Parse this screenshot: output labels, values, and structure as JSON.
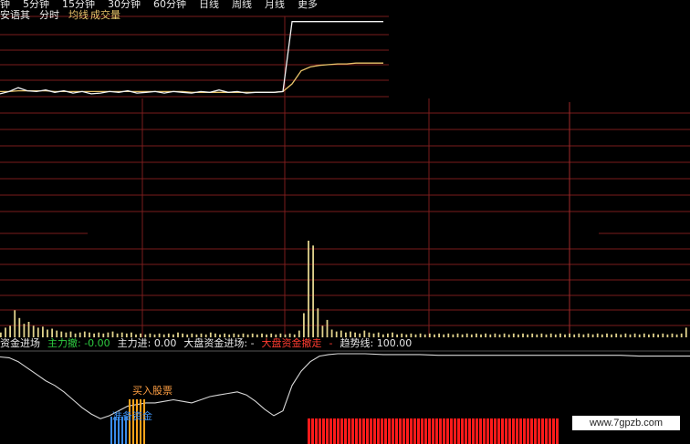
{
  "colors": {
    "background": "#000000",
    "grid_red": "#7a1d1d",
    "price_white": "#f2f2f2",
    "avg_yellow": "#e9c46a",
    "vol_bar": "#e0d28c",
    "legend_green": "#2ecc40",
    "legend_red": "#ff3b30",
    "text_white": "#e8e8e8",
    "buy_label": "#ff9f43",
    "blue_bar": "#3a8be8",
    "orange_bar": "#ffa31a",
    "red_block": "#ff1a1a"
  },
  "tabs": [
    "钟",
    "5分钟",
    "15分钟",
    "30分钟",
    "60分钟",
    "日线",
    "周线",
    "月线",
    "更多"
  ],
  "toolbar2": {
    "item1": "安语其",
    "item2": "分时",
    "item3": "均线",
    "item4": "成交量"
  },
  "indicator_legend": {
    "name": "资金进场",
    "zl_out": "主力撤: -0.00",
    "zl_in": "主力进: 0.00",
    "market_in": "大盘资金进场: -",
    "market_out": "大盘资金撤走",
    "dash": "-",
    "trend": "趋势线: 100.00"
  },
  "labels": {
    "buy_stock": "买入股票",
    "prepare_funds": "准备资金"
  },
  "watermark": "www.7gpzb.com",
  "chart_data": [
    {
      "type": "line",
      "panel": "intraday price",
      "x": [
        0,
        10,
        20,
        30,
        40,
        50,
        60,
        70,
        80,
        90,
        100,
        110,
        120,
        130,
        140,
        150,
        160,
        170,
        180,
        190,
        200,
        210,
        220,
        230,
        240,
        250,
        260,
        270,
        280,
        290,
        300,
        310,
        320,
        330,
        340,
        350,
        360,
        370,
        380,
        390,
        400,
        410,
        420
      ],
      "series": [
        {
          "values": [
            0.6,
            0.9,
            1.4,
            1.0,
            0.9,
            1.1,
            0.8,
            1.0,
            0.7,
            0.9,
            0.6,
            0.7,
            0.9,
            0.8,
            1.0,
            0.7,
            0.8,
            0.9,
            0.7,
            0.9,
            0.8,
            0.7,
            0.9,
            0.8,
            1.1,
            0.8,
            0.9,
            0.7,
            0.8,
            0.8,
            0.8,
            0.9,
            10.0,
            10.0,
            10.0,
            10.0,
            10.0,
            10.0,
            10.0,
            10.0,
            10.0,
            10.0,
            10.0
          ]
        },
        {
          "values": [
            0.9,
            0.9,
            1.0,
            1.0,
            1.0,
            1.0,
            0.9,
            0.9,
            0.9,
            0.9,
            0.9,
            0.9,
            0.9,
            0.9,
            0.9,
            0.9,
            0.9,
            0.9,
            0.9,
            0.9,
            0.9,
            0.8,
            0.8,
            0.8,
            0.8,
            0.8,
            0.8,
            0.8,
            0.8,
            0.8,
            0.8,
            0.9,
            1.9,
            3.6,
            4.1,
            4.3,
            4.4,
            4.5,
            4.5,
            4.6,
            4.6,
            4.6,
            4.6
          ]
        }
      ]
    },
    {
      "type": "bar",
      "panel": "volume",
      "values": [
        0.05,
        0.1,
        0.12,
        0.28,
        0.2,
        0.14,
        0.16,
        0.12,
        0.1,
        0.11,
        0.08,
        0.09,
        0.07,
        0.06,
        0.05,
        0.06,
        0.04,
        0.05,
        0.06,
        0.05,
        0.04,
        0.05,
        0.04,
        0.05,
        0.06,
        0.04,
        0.05,
        0.04,
        0.05,
        0.03,
        0.04,
        0.03,
        0.04,
        0.03,
        0.04,
        0.03,
        0.04,
        0.03,
        0.05,
        0.04,
        0.03,
        0.04,
        0.03,
        0.04,
        0.03,
        0.05,
        0.04,
        0.03,
        0.04,
        0.03,
        0.04,
        0.03,
        0.04,
        0.03,
        0.04,
        0.03,
        0.04,
        0.03,
        0.04,
        0.03,
        0.04,
        0.03,
        0.04,
        0.03,
        0.07,
        0.25,
        1.0,
        0.95,
        0.3,
        0.12,
        0.18,
        0.08,
        0.06,
        0.07,
        0.05,
        0.06,
        0.05,
        0.04,
        0.07,
        0.05,
        0.04,
        0.05,
        0.03,
        0.04,
        0.05,
        0.03,
        0.04,
        0.03,
        0.04,
        0.03,
        0.04,
        0.03,
        0.04,
        0.03,
        0.04,
        0.03,
        0.04,
        0.03,
        0.04,
        0.03,
        0.04,
        0.03,
        0.04,
        0.03,
        0.04,
        0.03,
        0.04,
        0.03,
        0.04,
        0.03,
        0.04,
        0.03,
        0.04,
        0.03,
        0.04,
        0.03,
        0.04,
        0.03,
        0.04,
        0.03,
        0.04,
        0.03,
        0.04,
        0.03,
        0.04,
        0.03,
        0.04,
        0.03,
        0.04,
        0.03,
        0.04,
        0.03,
        0.04,
        0.03,
        0.04,
        0.03,
        0.04,
        0.03,
        0.04,
        0.03,
        0.04,
        0.03,
        0.04,
        0.03,
        0.04,
        0.03,
        0.04,
        0.1
      ]
    },
    {
      "type": "line",
      "panel": "indicator trend",
      "x": [
        0,
        10,
        20,
        30,
        40,
        50,
        60,
        70,
        80,
        90,
        100,
        110,
        120,
        130,
        140,
        150,
        160,
        170,
        180,
        190,
        200,
        210,
        220,
        230,
        240,
        250,
        260,
        270,
        280,
        290,
        300,
        310,
        320,
        330,
        340,
        350,
        360,
        370,
        380,
        390,
        400,
        420,
        440,
        460,
        480,
        500,
        520,
        540,
        560,
        580,
        600,
        620,
        640,
        660,
        680,
        700,
        720,
        740,
        756
      ],
      "values": [
        96,
        95,
        90,
        82,
        74,
        66,
        60,
        52,
        42,
        32,
        24,
        18,
        22,
        28,
        34,
        36,
        38,
        38,
        40,
        42,
        40,
        38,
        42,
        46,
        48,
        50,
        52,
        48,
        40,
        30,
        22,
        28,
        60,
        78,
        90,
        97,
        99,
        100,
        100,
        100,
        100,
        99,
        99,
        99,
        98,
        98,
        98,
        98,
        98,
        98,
        98,
        98,
        98,
        98,
        98,
        97,
        97,
        97,
        97
      ]
    }
  ]
}
